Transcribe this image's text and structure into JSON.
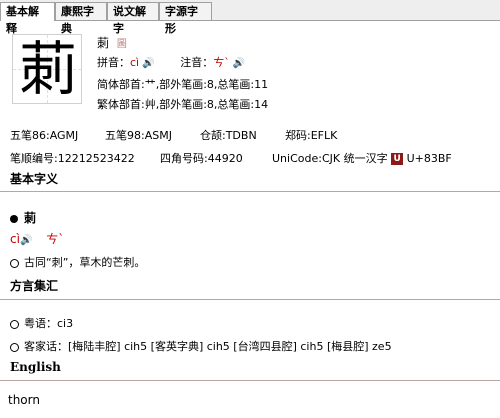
{
  "tabs": [
    {
      "label": "基本解释"
    },
    {
      "label": "康熙字典"
    },
    {
      "label": "说文解字"
    },
    {
      "label": "字源字形"
    }
  ],
  "character": {
    "glyph": "莿",
    "small": "莿",
    "small_icon": "圖",
    "pinyin_label": "拼音：",
    "pinyin": "cì",
    "zhuyin_label": "注音：",
    "zhuyin": "ㄘˋ",
    "simplified_radical": "简体部首:艹,部外笔画:8,总笔画:11",
    "traditional_radical": "繁体部首:艸,部外笔画:8,总笔画:14"
  },
  "codes": {
    "wubi86": "五笔86:AGMJ",
    "wubi98": "五笔98:ASMJ",
    "cangjie": "仓颉:TDBN",
    "zhengma": "郑码:EFLK",
    "stroke_order": "笔顺编号:12212523422",
    "four_corner": "四角号码:44920",
    "unicode": "UniCode:CJK 统一汉字",
    "unicode_icon": "U",
    "unicode_value": "U+83BF"
  },
  "basic": {
    "heading": "基本字义",
    "entry_char": "莿",
    "pinyin": "cì",
    "zhuyin": "ㄘˋ",
    "definition": "古同“刺”，草木的芒刺。"
  },
  "dialect": {
    "heading": "方言集汇",
    "cantonese": "粤语：ci3",
    "hakka": "客家话：[梅陆丰腔] cih5 [客英字典] cih5 [台湾四县腔] cih5 [梅县腔] ze5"
  },
  "english": {
    "heading": "English",
    "value": "thorn"
  },
  "icons": {
    "speaker": "speaker-icon"
  }
}
